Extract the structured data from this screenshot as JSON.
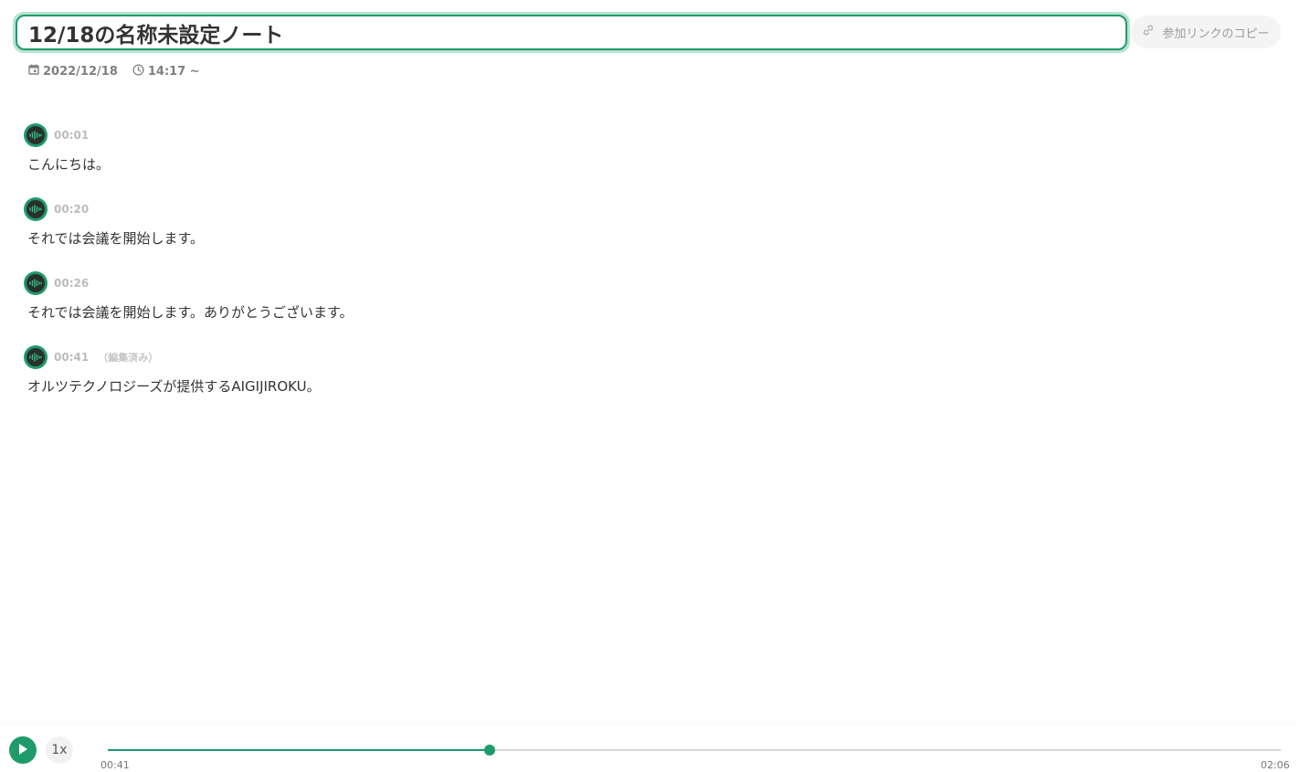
{
  "note": {
    "title": "12/18の名称未設定ノート",
    "copy_link_label": "参加リンクのコピー",
    "date": "2022/12/18",
    "time": "14:17 ~"
  },
  "transcript": [
    {
      "timestamp": "00:01",
      "edited": "",
      "text": "こんにちは。"
    },
    {
      "timestamp": "00:20",
      "edited": "",
      "text": "それでは会議を開始します。"
    },
    {
      "timestamp": "00:26",
      "edited": "",
      "text": "それでは会議を開始します。ありがとうございます。"
    },
    {
      "timestamp": "00:41",
      "edited": "（編集済み）",
      "text": "オルツテクノロジーズが提供するAIGIJIROKU。"
    }
  ],
  "player": {
    "speed_label": "1x",
    "current_time": "00:41",
    "duration": "02:06",
    "progress": 0.3254
  },
  "colors": {
    "accent": "#1f9a6b",
    "accent_light": "#b9e3cf",
    "avatar_dark": "#2a2f2d"
  },
  "icons": {
    "copy": "link-icon",
    "date": "calendar-icon",
    "time": "clock-icon",
    "avatar": "sound-wave-icon",
    "play": "play-icon"
  }
}
